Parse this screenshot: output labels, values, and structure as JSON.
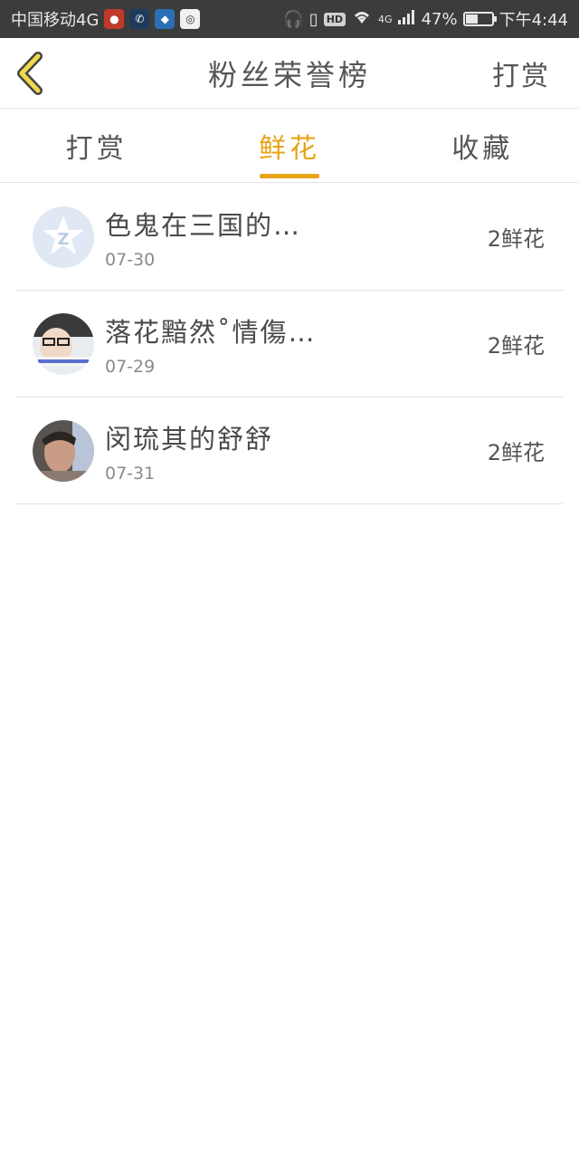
{
  "status_bar": {
    "carrier": "中国移动4G",
    "hd": "HD",
    "network": "4G",
    "battery": "47%",
    "battery_level": 0.47,
    "time": "下午4:44"
  },
  "header": {
    "title": "粉丝荣誉榜",
    "action_label": "打赏",
    "accent_color": "#e8a317"
  },
  "tabs": [
    {
      "label": "打赏",
      "active": false
    },
    {
      "label": "鲜花",
      "active": true
    },
    {
      "label": "收藏",
      "active": false
    }
  ],
  "list": [
    {
      "name": "色鬼在三国的…",
      "date": "07-30",
      "amount": "2鲜花",
      "avatar": "default-avatar-icon"
    },
    {
      "name": "落花黯然˚情傷…",
      "date": "07-29",
      "amount": "2鲜花",
      "avatar": "user-photo"
    },
    {
      "name": "闵琉其的舒舒",
      "date": "07-31",
      "amount": "2鲜花",
      "avatar": "user-photo"
    }
  ]
}
